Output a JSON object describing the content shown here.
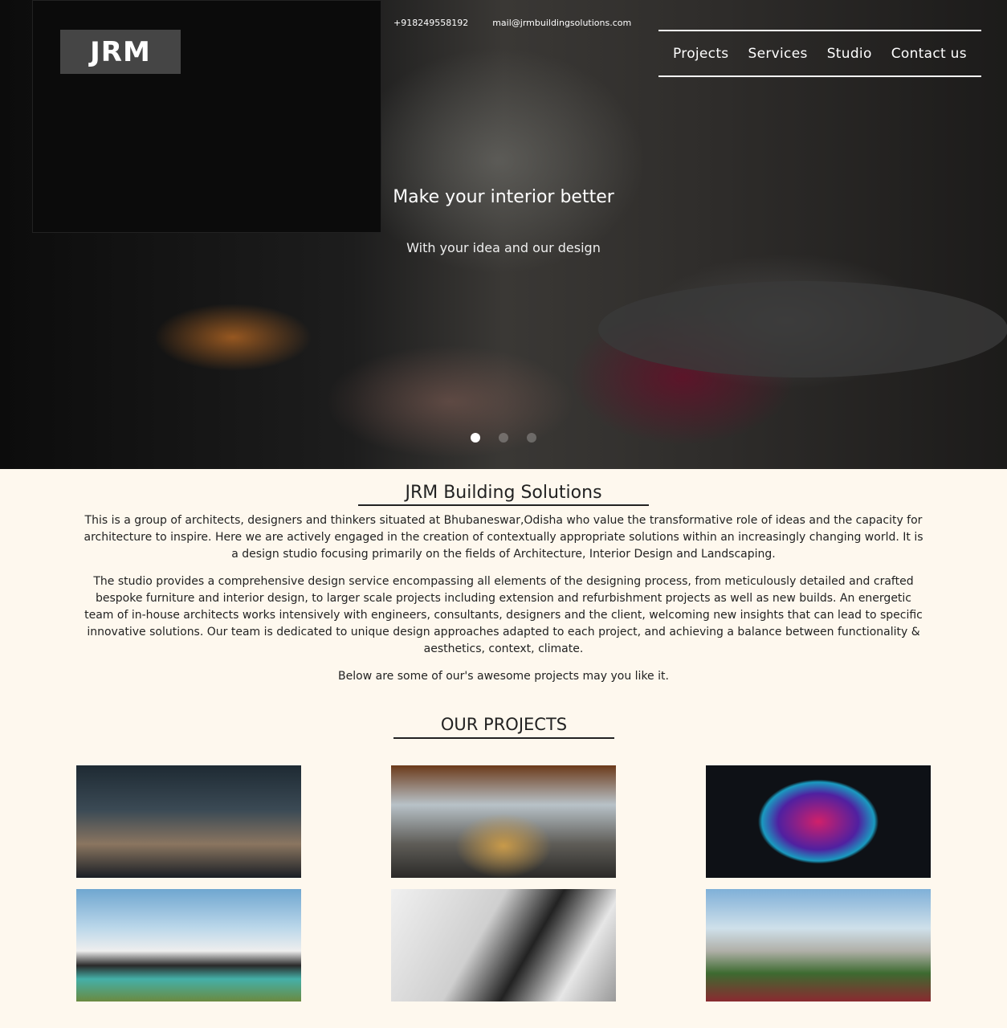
{
  "header": {
    "logo": "JRM",
    "phone": "+918249558192",
    "email": "mail@jrmbuildingsolutions.com",
    "nav": [
      {
        "label": "Projects"
      },
      {
        "label": "Services"
      },
      {
        "label": "Studio"
      },
      {
        "label": "Contact us"
      }
    ]
  },
  "hero": {
    "title": "Make your interior better",
    "subtitle": "With your idea and our design",
    "slides_total": 3,
    "active_slide": 1
  },
  "about": {
    "title": "JRM Building Solutions",
    "paragraphs": [
      "This is a group of architects, designers and thinkers situated at Bhubaneswar,Odisha who value the transformative role of ideas and the capacity for architecture to inspire. Here we are actively engaged in the creation of contextually appropriate solutions within an increasingly changing world. It is a design studio focusing primarily on the fields of Architecture, Interior Design and Landscaping.",
      "The studio provides a comprehensive design service encompassing all elements of the designing process, from meticulously detailed and crafted bespoke furniture and interior design, to larger scale projects including extension and refurbishment projects as well as new builds. An energetic team of in-house architects works intensively with engineers, consultants, designers and the client, welcoming new insights that can lead to specific innovative solutions. Our team is dedicated to unique design approaches adapted to each project, and achieving a balance between functionality & aesthetics, context, climate.",
      "Below are some of our's awesome projects may you like it."
    ]
  },
  "projects": {
    "title": "OUR PROJECTS"
  },
  "colors": {
    "background": "#fef8ee",
    "text": "#222222"
  }
}
